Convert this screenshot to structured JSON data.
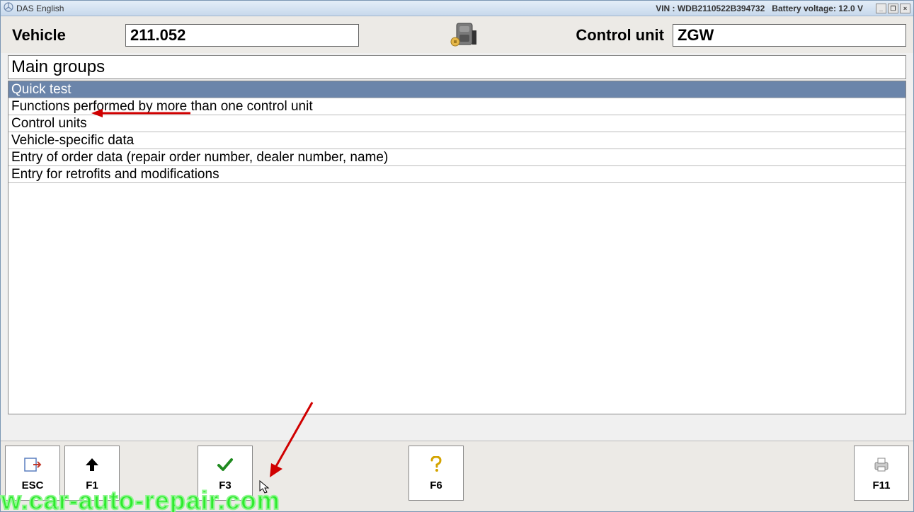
{
  "titlebar": {
    "app_name": "DAS English",
    "vin_label": "VIN : WDB2110522B394732",
    "battery_label": "Battery voltage: 12.0 V"
  },
  "header": {
    "vehicle_label": "Vehicle",
    "vehicle_value": "211.052",
    "control_label": "Control unit",
    "control_value": "ZGW"
  },
  "section_title": "Main groups",
  "list": [
    {
      "label": "Quick test",
      "selected": true
    },
    {
      "label": "Functions performed by more than one control unit",
      "selected": false
    },
    {
      "label": "Control units",
      "selected": false
    },
    {
      "label": "Vehicle-specific data",
      "selected": false
    },
    {
      "label": "Entry of order data (repair order number, dealer number, name)",
      "selected": false
    },
    {
      "label": "Entry for retrofits and modifications",
      "selected": false
    }
  ],
  "footer": {
    "esc": "ESC",
    "f1": "F1",
    "f3": "F3",
    "f6": "F6",
    "f11": "F11"
  },
  "watermark": "vw.car-auto-repair.com"
}
